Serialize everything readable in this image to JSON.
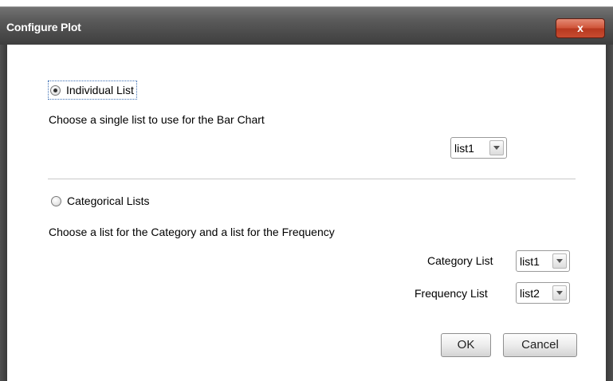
{
  "window": {
    "title": "Configure Plot",
    "close_label": "x"
  },
  "individual": {
    "radio_label": "Individual List",
    "selected": true,
    "description": "Choose a single list to use for the Bar Chart",
    "list_value": "list1"
  },
  "categorical": {
    "radio_label": "Categorical Lists",
    "selected": false,
    "description": "Choose a list for the Category and a list for the Frequency",
    "category_label": "Category List",
    "category_value": "list1",
    "frequency_label": "Frequency List",
    "frequency_value": "list2"
  },
  "buttons": {
    "ok": "OK",
    "cancel": "Cancel"
  },
  "colors": {
    "title_bar": "#4a4a4a",
    "close_button": "#c9472c"
  }
}
